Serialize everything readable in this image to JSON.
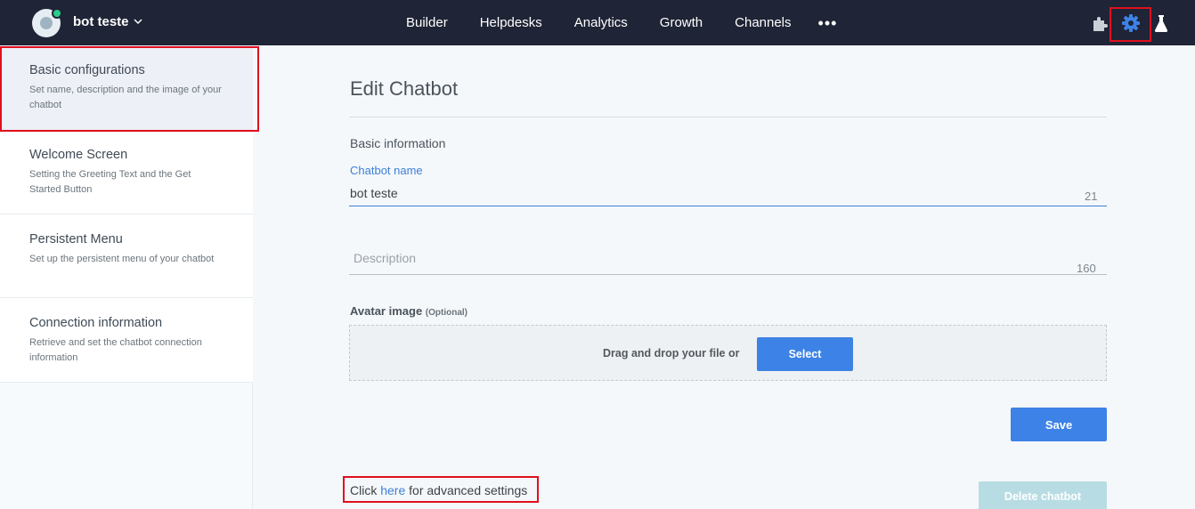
{
  "header": {
    "bot_name": "bot teste",
    "nav": [
      "Builder",
      "Helpdesks",
      "Analytics",
      "Growth",
      "Channels"
    ],
    "more": "•••"
  },
  "sidebar": {
    "items": [
      {
        "title": "Basic configurations",
        "desc": "Set name, description and the image of your chatbot"
      },
      {
        "title": "Welcome Screen",
        "desc": "Setting the Greeting Text and the Get Started Button"
      },
      {
        "title": "Persistent Menu",
        "desc": "Set up the persistent menu of your chatbot"
      },
      {
        "title": "Connection information",
        "desc": "Retrieve and set the chatbot connection information"
      }
    ]
  },
  "main": {
    "title": "Edit Chatbot",
    "section": "Basic information",
    "name_label": "Chatbot name",
    "name_value": "bot teste",
    "name_counter": "21",
    "description_placeholder": "Description",
    "description_counter": "160",
    "avatar_label": "Avatar image",
    "avatar_optional": "(Optional)",
    "drop_text": "Drag and drop your file or",
    "select_label": "Select",
    "save_label": "Save",
    "advanced_prefix": "Click ",
    "advanced_link": "here",
    "advanced_suffix": " for advanced settings",
    "delete_label": "Delete chatbot"
  },
  "colors": {
    "topbar": "#1f2436",
    "accent": "#3d82e6",
    "highlight": "#e0101f"
  }
}
